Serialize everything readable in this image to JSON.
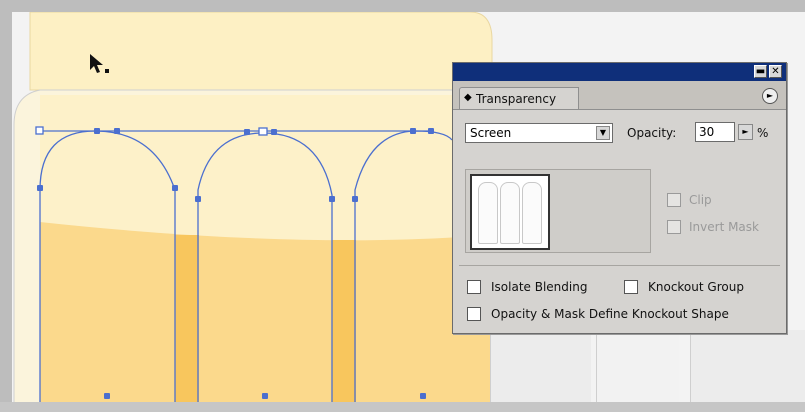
{
  "panel": {
    "title": "Transparency",
    "blend_mode": "Screen",
    "opacity_label": "Opacity:",
    "opacity_value": "30",
    "percent": "%",
    "clip_label": "Clip",
    "invert_mask_label": "Invert Mask",
    "isolate_blending_label": "Isolate Blending",
    "knockout_group_label": "Knockout Group",
    "opacity_mask_label": "Opacity & Mask Define Knockout Shape",
    "minimize_glyph": "▬",
    "close_glyph": "✕",
    "menu_glyph": "►",
    "dropdown_glyph": "▼",
    "stepper_glyph": "►",
    "tab_icon_glyph": "◆"
  },
  "colors": {
    "title_bar": "#0f2f7a",
    "panel_bg": "#d5d3d0",
    "selection": "#4b6fcf",
    "shape_light": "#fdf0c4",
    "shape_mid": "#fbd98c",
    "shape_dark": "#f8c65d"
  },
  "icons": {
    "cursor": "selection-arrow-icon",
    "panel_menu": "panel-menu-icon",
    "minimize": "minimize-icon",
    "close": "close-icon"
  }
}
